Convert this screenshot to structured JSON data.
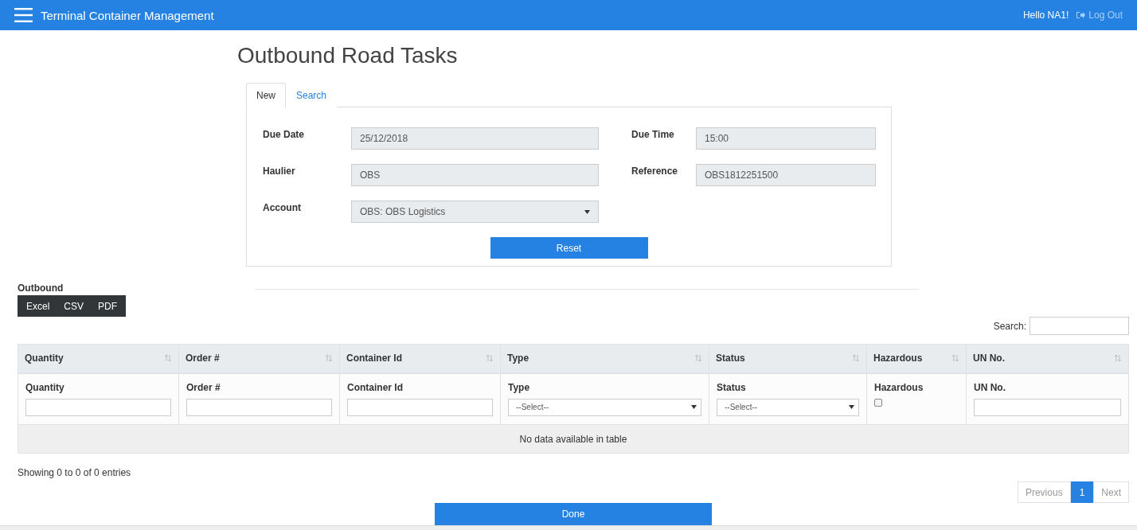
{
  "navbar": {
    "title": "Terminal Container Management",
    "greeting": "Hello NA1!",
    "logout": "Log Out"
  },
  "page_title": "Outbound Road Tasks",
  "tabs": [
    {
      "label": "New",
      "selected": true
    },
    {
      "label": "Search",
      "selected": false
    }
  ],
  "form": {
    "fields": [
      {
        "label": "Due Date",
        "value": "25/12/2018",
        "kind": "text"
      },
      {
        "label": "Due Time",
        "value": "15:00",
        "kind": "text"
      },
      {
        "label": "Haulier",
        "value": "OBS",
        "kind": "text"
      },
      {
        "label": "Reference",
        "value": "OBS1812251500",
        "kind": "text"
      },
      {
        "label": "Account",
        "value": "OBS: OBS Logistics",
        "kind": "select"
      }
    ],
    "reset_button": "Reset"
  },
  "outbound": {
    "label": "Outbound",
    "export_buttons": [
      "Excel",
      "CSV",
      "PDF"
    ],
    "search_label": "Search:"
  },
  "table": {
    "columns": [
      "Quantity",
      "Order #",
      "Container Id",
      "Type",
      "Status",
      "Hazardous",
      "UN No."
    ],
    "filters": [
      {
        "label": "Quantity",
        "kind": "text"
      },
      {
        "label": "Order #",
        "kind": "text"
      },
      {
        "label": "Container Id",
        "kind": "text"
      },
      {
        "label": "Type",
        "kind": "select",
        "placeholder": "--Select--"
      },
      {
        "label": "Status",
        "kind": "select",
        "placeholder": "--Select--"
      },
      {
        "label": "Hazardous",
        "kind": "checkbox",
        "checked": false
      },
      {
        "label": "UN No.",
        "kind": "text"
      }
    ],
    "empty_message": "No data available in table"
  },
  "info": "Showing 0 to 0 of 0 entries",
  "pagination": [
    {
      "label": "Previous",
      "selected": false,
      "disabled": true
    },
    {
      "label": "1",
      "selected": true,
      "disabled": false
    },
    {
      "label": "Next",
      "selected": false,
      "disabled": true
    }
  ],
  "done_button": "Done"
}
